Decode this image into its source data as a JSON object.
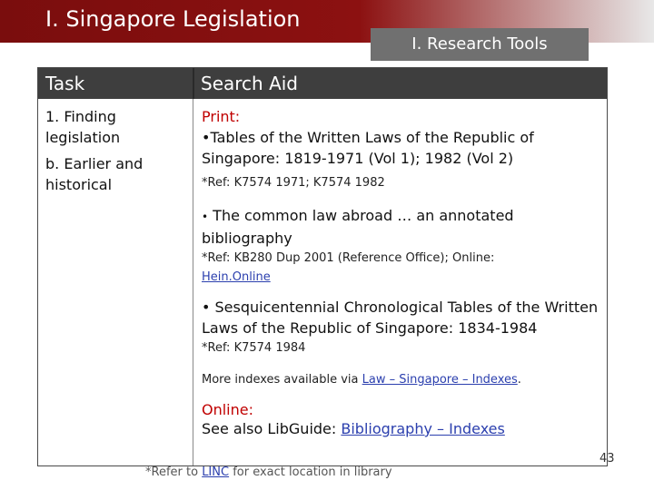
{
  "banner": {
    "title": "I. Singapore Legislation",
    "subtitle": "I. Research Tools"
  },
  "table": {
    "headers": {
      "task": "Task",
      "search_aid": "Search Aid"
    },
    "task_col": [
      "1. Finding legislation",
      "b. Earlier and historical"
    ],
    "print_label": "Print:",
    "items": [
      {
        "title": "•Tables of the Written Laws of the Republic of Singapore: 1819-1971 (Vol 1); 1982 (Vol 2)",
        "ref": "*Ref: K7574 1971; K7574 1982"
      },
      {
        "bullet": "•",
        "title": " The common law abroad … an annotated bibliography",
        "ref_prefix": "*Ref: KB280 Dup 2001 (Reference Office); Online:",
        "ref_link": "Hein.Online"
      },
      {
        "title": "• Sesquicentennial Chronological Tables of the Written Laws of the Republic of Singapore: 1834-1984",
        "ref": "*Ref: K7574 1984"
      }
    ],
    "more": {
      "prefix": "More indexes available via ",
      "link": "Law – Singapore – Indexes",
      "suffix": "."
    },
    "online_label": "Online:",
    "see_also": {
      "prefix": "See also LibGuide: ",
      "link": "Bibliography – Indexes"
    }
  },
  "footnote": {
    "prefix": "*Refer to ",
    "link": "LINC",
    "suffix": " for exact location in library"
  },
  "page_number": "43",
  "colors": {
    "banner": "#8c1111",
    "header_bg": "#3e3e3e",
    "accent_red": "#c00000",
    "link": "#2b3fae"
  }
}
